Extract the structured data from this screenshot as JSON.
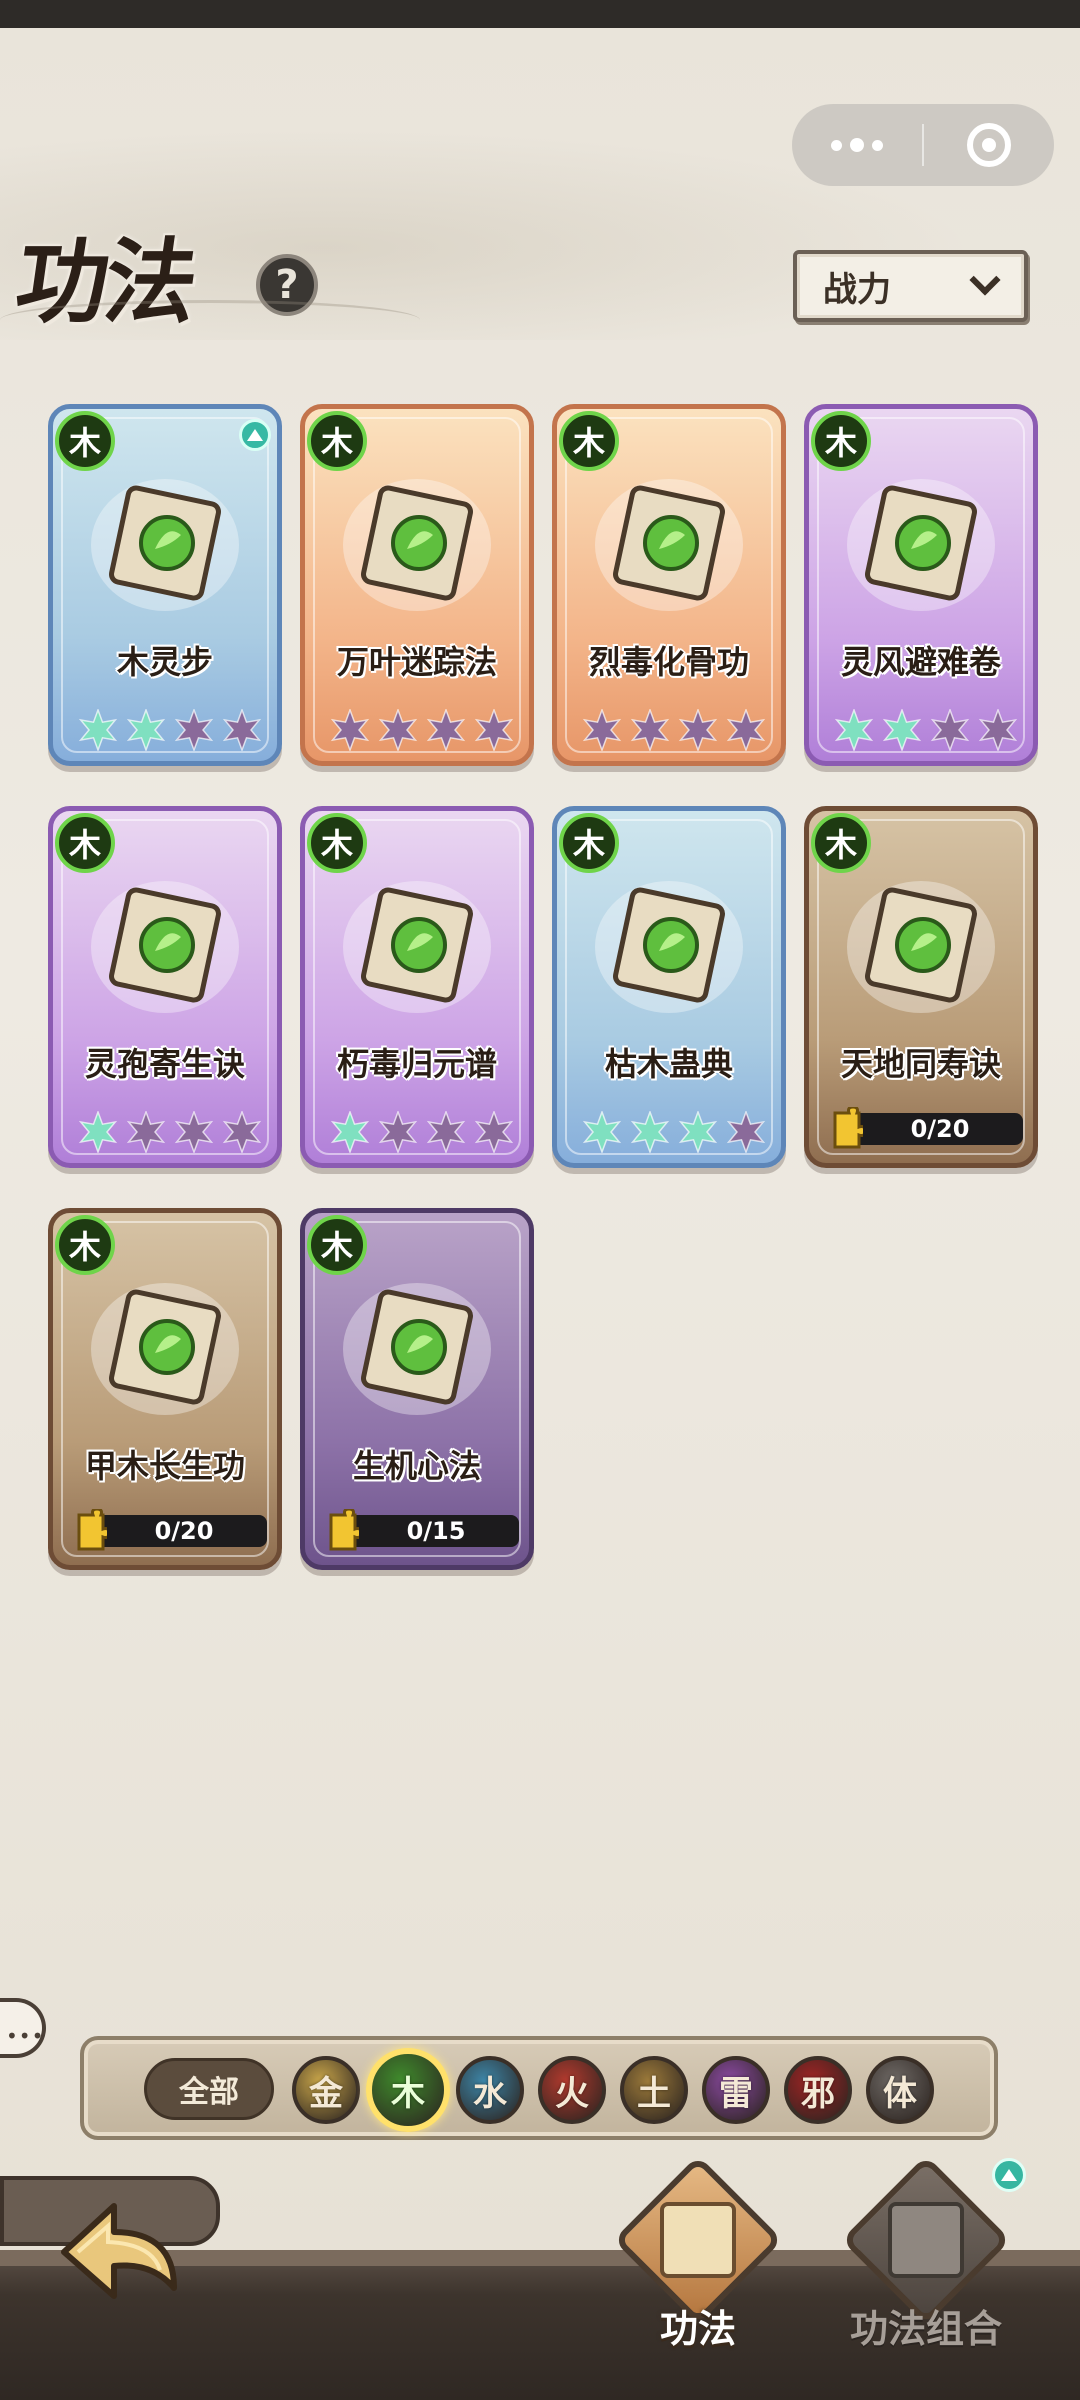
{
  "page": {
    "title": "功法",
    "help": "?"
  },
  "sort": {
    "selected": "战力"
  },
  "cards": [
    {
      "name": "木灵步",
      "element": "木",
      "rarity": "blue",
      "stars_filled": 2,
      "stars_total": 4,
      "upgrade": true
    },
    {
      "name": "万叶迷踪法",
      "element": "木",
      "rarity": "orange",
      "stars_filled": 0,
      "stars_total": 4
    },
    {
      "name": "烈毒化骨功",
      "element": "木",
      "rarity": "orange",
      "stars_filled": 0,
      "stars_total": 4
    },
    {
      "name": "灵风避难卷",
      "element": "木",
      "rarity": "purple",
      "stars_filled": 2,
      "stars_total": 4
    },
    {
      "name": "灵孢寄生诀",
      "element": "木",
      "rarity": "purple",
      "stars_filled": 1,
      "stars_total": 4
    },
    {
      "name": "朽毒归元谱",
      "element": "木",
      "rarity": "purple",
      "stars_filled": 1,
      "stars_total": 4
    },
    {
      "name": "枯木蛊典",
      "element": "木",
      "rarity": "blue",
      "stars_filled": 3,
      "stars_total": 4
    },
    {
      "name": "天地同寿诀",
      "element": "木",
      "rarity": "brown",
      "fragments": "0/20",
      "fragments_fraction": 0
    },
    {
      "name": "甲木长生功",
      "element": "木",
      "rarity": "brown",
      "fragments": "0/20",
      "fragments_fraction": 0
    },
    {
      "name": "生机心法",
      "element": "木",
      "rarity": "dpurple",
      "fragments": "0/15",
      "fragments_fraction": 0
    }
  ],
  "filter": {
    "all": "全部",
    "selected": "木",
    "elements": [
      {
        "label": "金",
        "color": "#c9a64a"
      },
      {
        "label": "木",
        "color": "#3f8a2c"
      },
      {
        "label": "水",
        "color": "#3d86a8"
      },
      {
        "label": "火",
        "color": "#b33a2e"
      },
      {
        "label": "土",
        "color": "#9c7a3a"
      },
      {
        "label": "雷",
        "color": "#8b4aa2"
      },
      {
        "label": "邪",
        "color": "#a12424"
      },
      {
        "label": "体",
        "color": "#6f6a66"
      }
    ]
  },
  "nav": {
    "tabs": [
      {
        "label": "功法",
        "active": true
      },
      {
        "label": "功法组合",
        "active": false
      }
    ]
  },
  "colors": {
    "star_lit": "#7fe0c0",
    "star_dim": "#8a6a9a"
  },
  "icons": [
    "more-dots-icon",
    "target-icon",
    "help-icon",
    "chevron-down-icon",
    "star-icon",
    "puzzle-piece-icon",
    "back-arrow-icon",
    "scroll-icon",
    "upgrade-arrow-icon",
    "chat-bubble-icon"
  ]
}
